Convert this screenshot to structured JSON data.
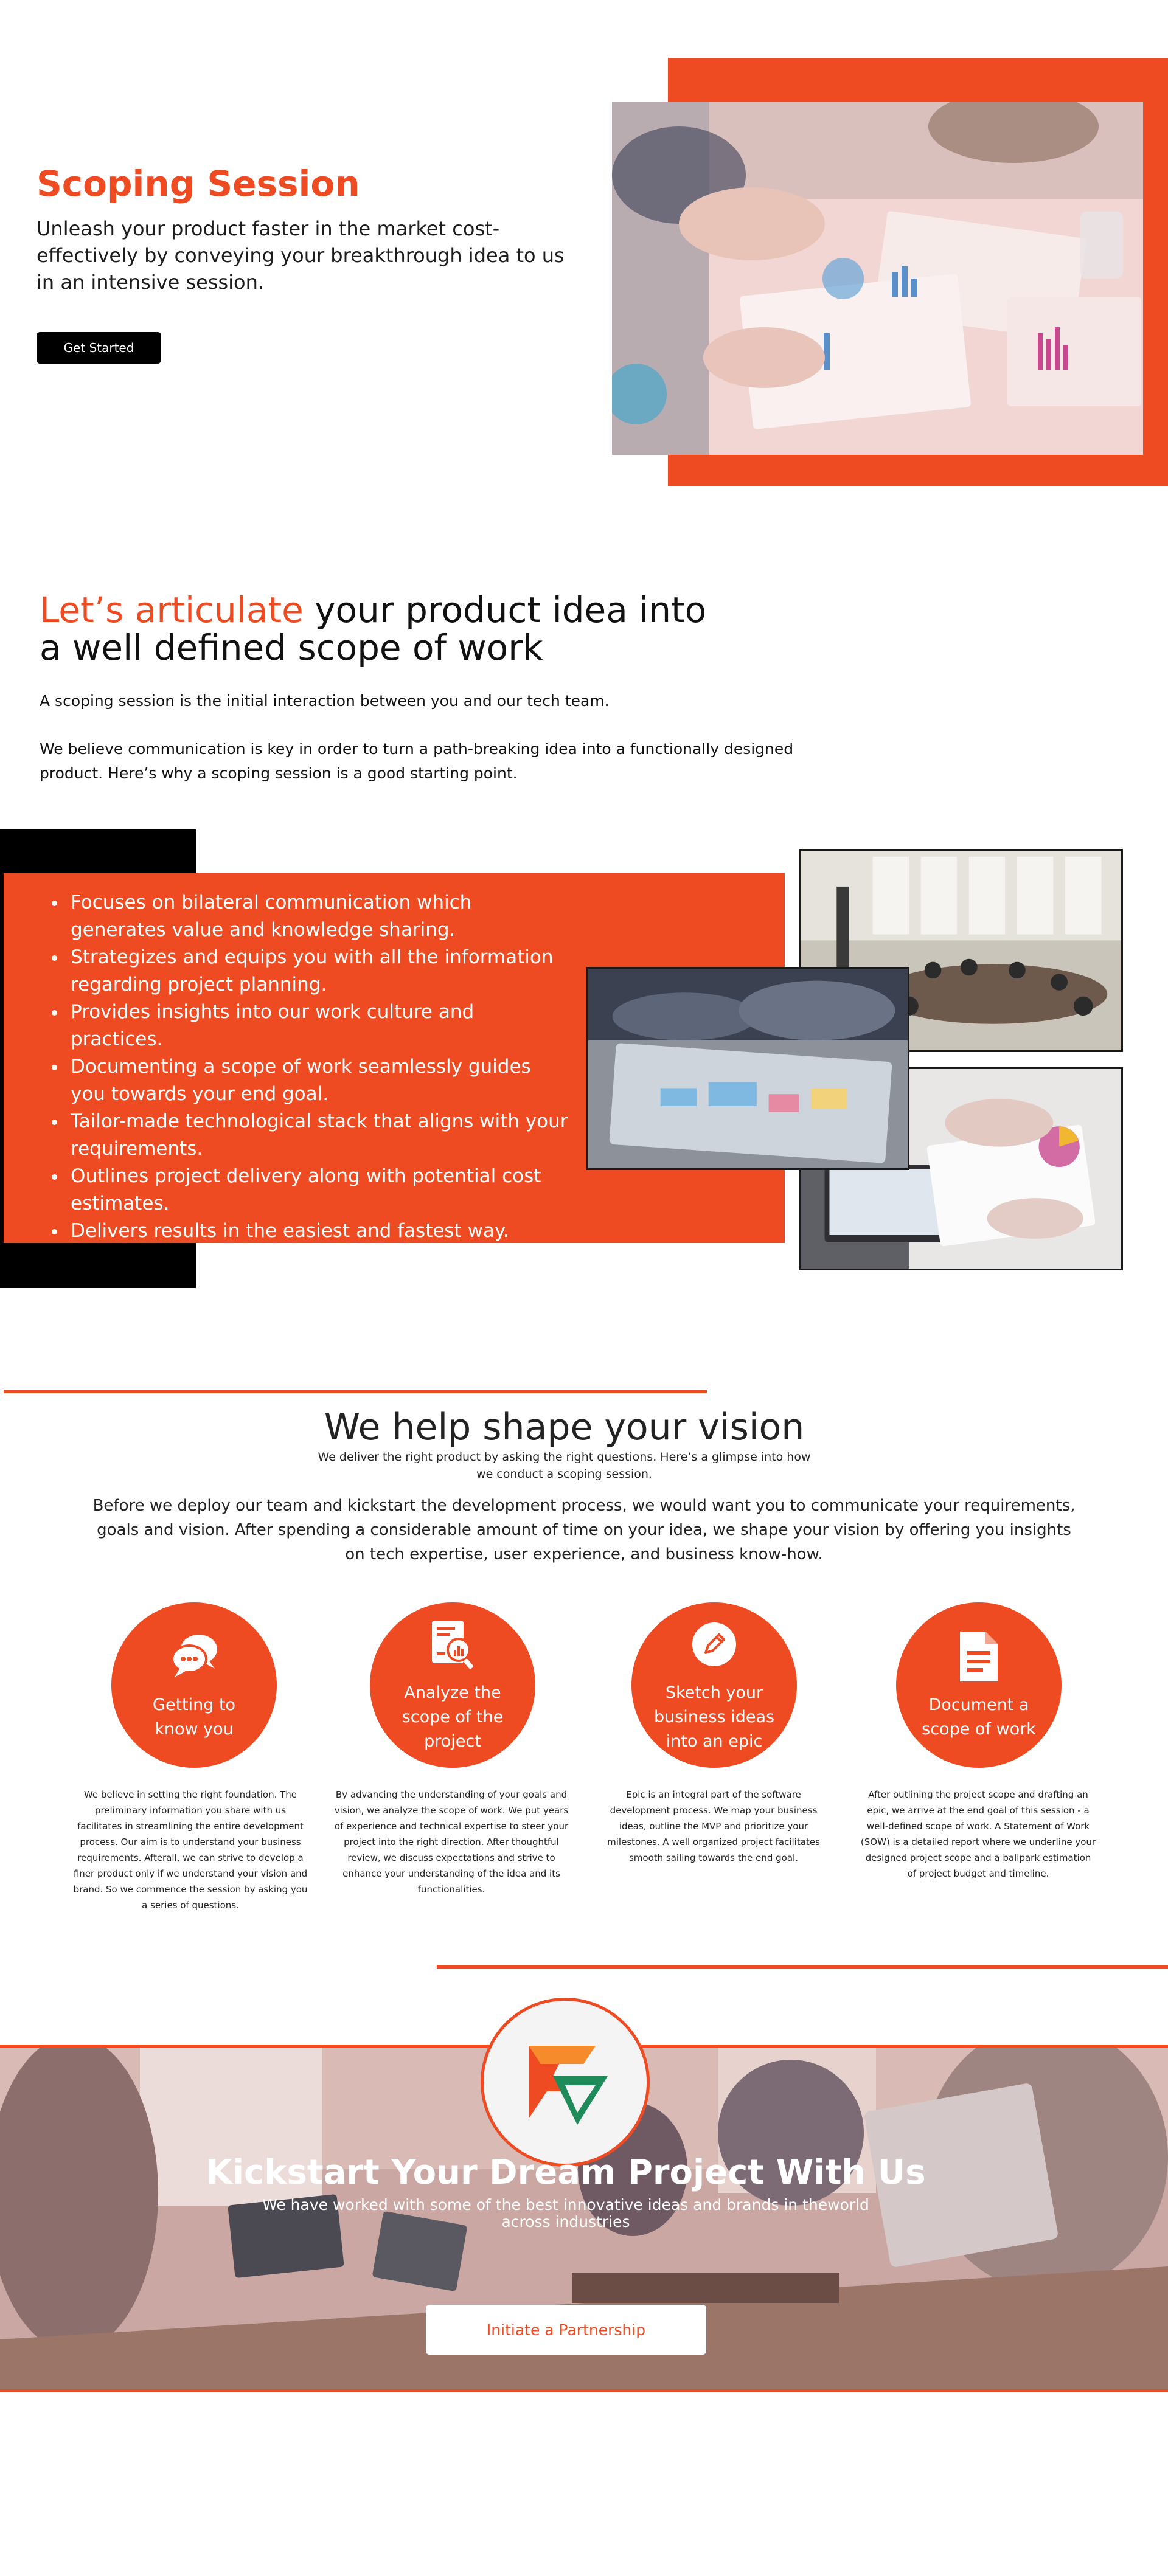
{
  "hero": {
    "title": "Scoping Session",
    "subtitle": "Unleash your product faster in the market cost-effectively by conveying your breakthrough idea to us in an intensive session.",
    "cta_label": "Get Started",
    "accent_color": "#ee4b23"
  },
  "articulate": {
    "title_highlight": "Let’s articulate",
    "title_line1_rest": " your product idea into",
    "title_line2": "a well defined scope of work",
    "paragraph1": "A scoping session is the initial interaction between you and our tech team.",
    "paragraph2": "We believe communication is key in order to turn a path-breaking idea into a functionally designed product. Here’s why a scoping session is a good starting point."
  },
  "benefits": {
    "items": [
      "Focuses on bilateral communication which generates value and knowledge sharing.",
      "Strategizes and equips you with all the information regarding project planning.",
      "Provides insights into our work culture and practices.",
      "Documenting a scope of work seamlessly guides you towards your end goal.",
      "Tailor-made technological stack that aligns with your requirements.",
      "Outlines project delivery along with potential cost estimates.",
      "Delivers results in the easiest and fastest way."
    ]
  },
  "shape": {
    "title": "We help shape your vision",
    "subtitle": "We deliver the right product by asking the right questions. Here’s a glimpse into how we conduct a scoping session.",
    "body": "Before we deploy our team and kickstart the development process, we would want you to communicate your requirements, goals and vision. After spending a considerable amount of time on your idea, we shape your vision by offering you insights on tech expertise, user experience, and business know-how.",
    "steps": [
      {
        "label": "Getting to know you",
        "icon": "chat-bubbles-icon",
        "description": "We believe in setting the right foundation. The preliminary information you share with us facilitates in streamlining the entire development process. Our aim is to understand your business requirements. Afterall, we can strive to develop a finer product only if we understand your vision and brand. So we commence the session by asking you a series of questions."
      },
      {
        "label": "Analyze the scope of the project",
        "icon": "report-analysis-icon",
        "description": "By advancing the understanding of your goals and vision, we analyze the scope of work. We put years of experience and technical expertise to steer your project into the right direction. After thoughtful review, we discuss expectations and strive to enhance your understanding of the idea and its functionalities."
      },
      {
        "label": "Sketch your business ideas into an epic",
        "icon": "pencil-icon",
        "description": "Epic is an integral part of the software development process. We map your business ideas, outline the MVP and prioritize your milestones. A well organized project facilitates smooth sailing towards the end goal."
      },
      {
        "label": "Document a scope of work",
        "icon": "document-icon",
        "description": "After outlining the project scope and drafting an epic, we arrive at the end goal of this session - a well-defined scope of work. A Statement of Work (SOW) is a detailed report where we underline your designed project scope and a ballpark estimation of project budget and timeline."
      }
    ]
  },
  "kickstart": {
    "title": "Kickstart Your Dream Project With Us",
    "subtitle": "We have worked with some of the best innovative ideas and brands in theworld across industries",
    "cta_label": "Initiate a Partnership"
  }
}
